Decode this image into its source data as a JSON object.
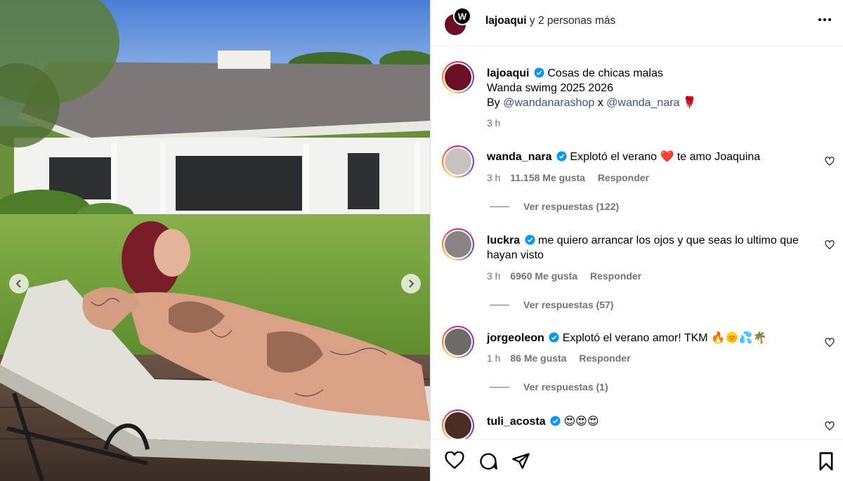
{
  "header": {
    "username": "lajoaqui",
    "suffix": "y 2 personas más",
    "avatar_letter": "W"
  },
  "caption": {
    "username": "lajoaqui",
    "line1": "Cosas de chicas malas",
    "line2": "Wanda swimg 2025 2026",
    "by_label": "By",
    "mention1": "@wandanarashop",
    "x_label": "x",
    "mention2": "@wanda_nara",
    "emoji": "🌹",
    "time": "3 h"
  },
  "comments": [
    {
      "username": "wanda_nara",
      "text_before": "Explotó el verano",
      "emoji": "❤️",
      "text_after": "te amo Joaquina",
      "time": "3 h",
      "likes": "11.158 Me gusta",
      "reply": "Responder",
      "replies": "Ver respuestas (122)"
    },
    {
      "username": "luckra",
      "text": "me quiero arrancar los ojos y que seas lo ultimo que hayan visto",
      "time": "3 h",
      "likes": "6960 Me gusta",
      "reply": "Responder",
      "replies": "Ver respuestas (57)"
    },
    {
      "username": "jorgeoleon",
      "text": "Explotó el verano amor! TKM 🔥🌞💦🌴",
      "time": "1 h",
      "likes": "86 Me gusta",
      "reply": "Responder",
      "replies": "Ver respuestas (1)"
    },
    {
      "username": "tuli_acosta",
      "text": "😍😍😍"
    }
  ],
  "icons": {
    "like": "heart-icon",
    "comment": "comment-icon",
    "share": "send-icon",
    "save": "bookmark-icon"
  },
  "colors": {
    "verified": "#0095f6",
    "link": "#385185",
    "muted": "#737373",
    "avatar_main": "#6b0f24"
  }
}
